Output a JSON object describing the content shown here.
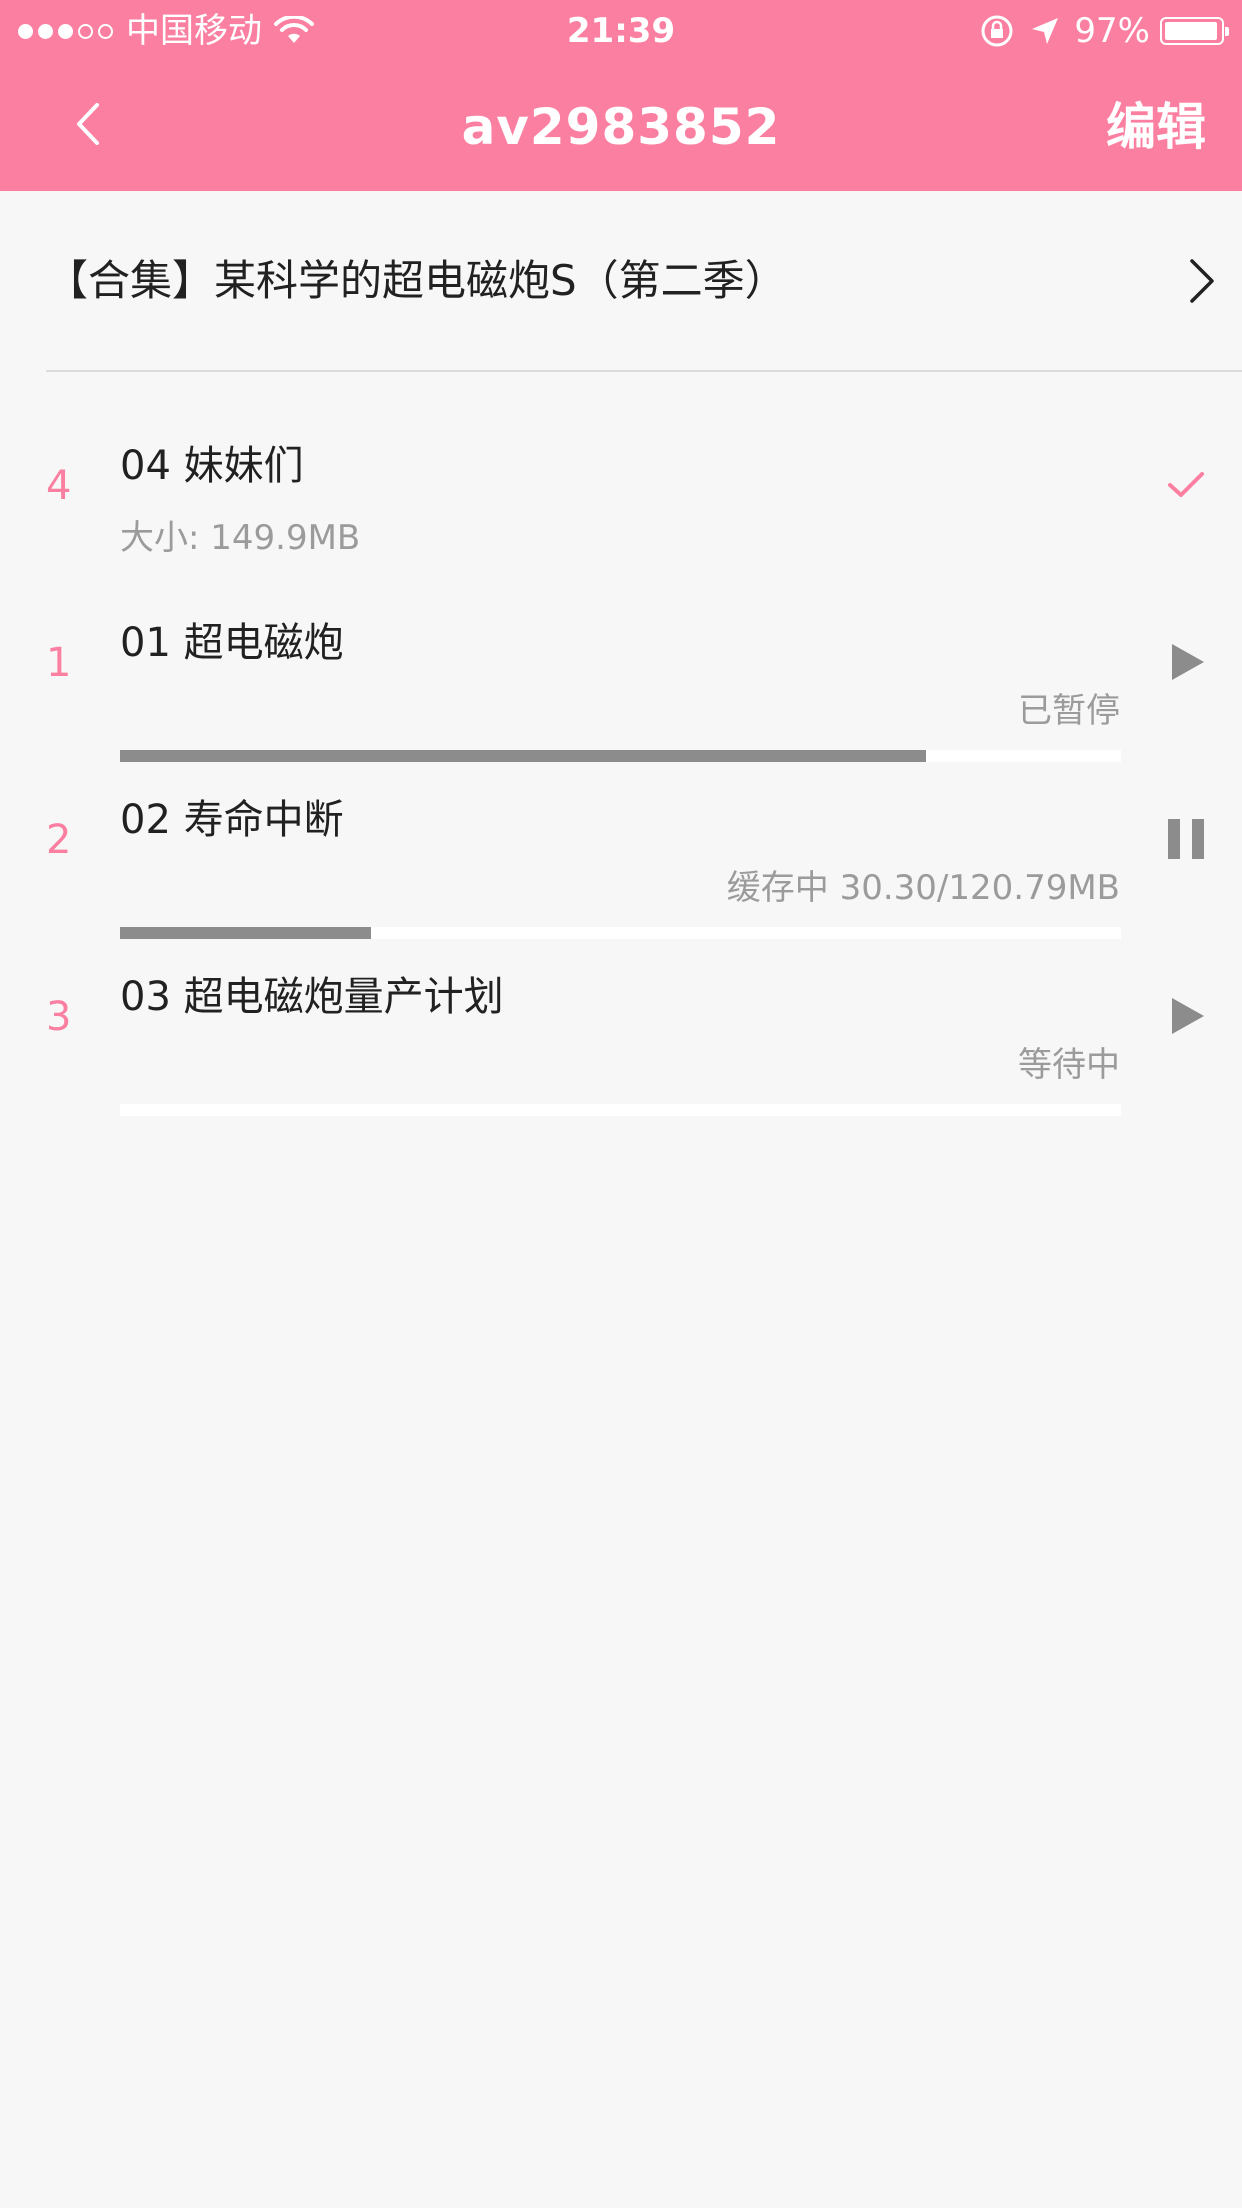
{
  "status_bar": {
    "signal_filled": 3,
    "signal_total": 5,
    "carrier": "中国移动",
    "time": "21:39",
    "battery_percent": "97%",
    "battery_level": 0.97
  },
  "nav": {
    "title": "av2983852",
    "edit_label": "编辑"
  },
  "collection": {
    "title": "【合集】某科学的超电磁炮S（第二季）"
  },
  "colors": {
    "accent": "#fb7fa0",
    "progress": "#8c8c8c",
    "text_primary": "#212121",
    "text_secondary": "#9b9b9b",
    "background": "#f7f7f7"
  },
  "downloads": [
    {
      "index": "4",
      "title": "04 妹妹们",
      "size": "大小: 149.9MB",
      "status": "",
      "progress": null,
      "action_icon": "checkmark-icon"
    },
    {
      "index": "1",
      "title": "01 超电磁炮",
      "size": "",
      "status": "已暂停",
      "progress": 0.805,
      "action_icon": "play-icon"
    },
    {
      "index": "2",
      "title": "02 寿命中断",
      "size": "",
      "status": "缓存中 30.30/120.79MB",
      "progress": 0.251,
      "action_icon": "pause-icon"
    },
    {
      "index": "3",
      "title": "03 超电磁炮量产计划",
      "size": "",
      "status": "等待中",
      "progress": 0,
      "action_icon": "play-icon"
    }
  ]
}
